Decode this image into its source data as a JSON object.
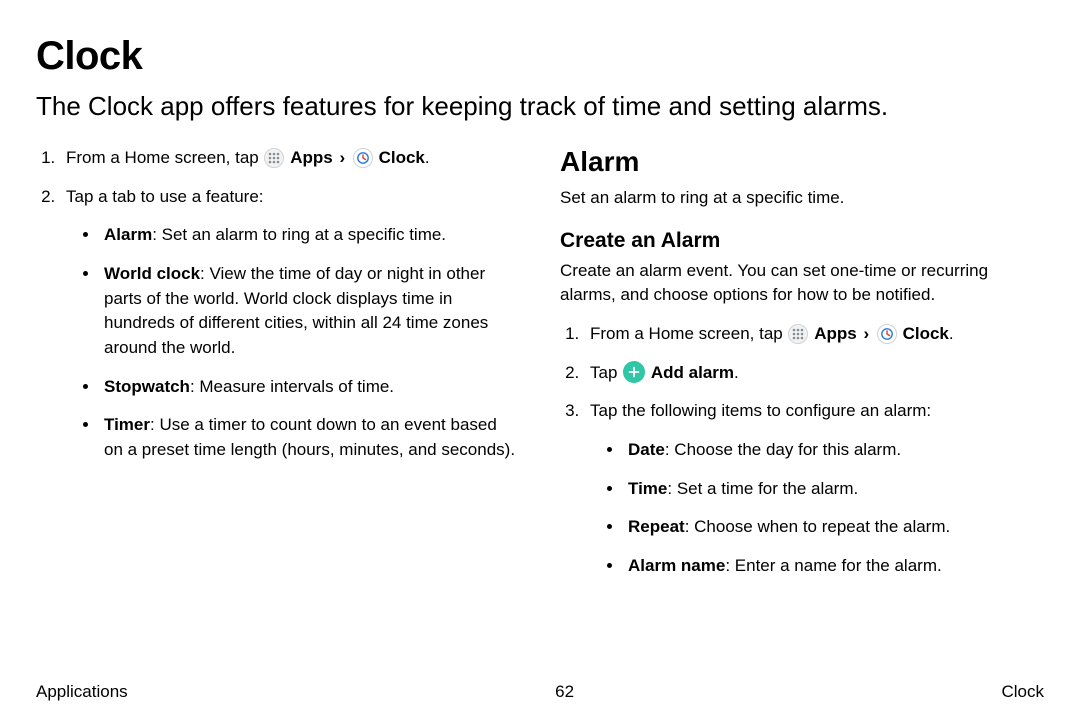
{
  "title": "Clock",
  "intro": "The Clock app offers features for keeping track of time and setting alarms.",
  "left": {
    "step1_prefix": "From a Home screen, tap ",
    "apps_label": "Apps",
    "chevron": "›",
    "clock_label": "Clock",
    "step1_suffix": ".",
    "step2": "Tap a tab to use a feature:",
    "bullets": [
      {
        "term": "Alarm",
        "desc": ": Set an alarm to ring at a specific time."
      },
      {
        "term": "World clock",
        "desc": ": View the time of day or night in other parts of the world. World clock displays time in hundreds of different cities, within all 24 time zones around the world."
      },
      {
        "term": "Stopwatch",
        "desc": ": Measure intervals of time."
      },
      {
        "term": "Timer",
        "desc": ": Use a timer to count down to an event based on a preset time length (hours, minutes, and seconds)."
      }
    ]
  },
  "right": {
    "h2": "Alarm",
    "h2_desc": "Set an alarm to ring at a specific time.",
    "h3": "Create an Alarm",
    "h3_desc": "Create an alarm event. You can set one-time or recurring alarms, and choose options for how to be notified.",
    "step1_prefix": "From a Home screen, tap ",
    "apps_label": "Apps",
    "chevron": "›",
    "clock_label": "Clock",
    "step1_suffix": ".",
    "step2_prefix": "Tap ",
    "add_alarm_label": "Add alarm",
    "step2_suffix": ".",
    "step3": "Tap the following items to configure an alarm:",
    "bullets": [
      {
        "term": "Date",
        "desc": ": Choose the day for this alarm."
      },
      {
        "term": "Time",
        "desc": ": Set a time for the alarm."
      },
      {
        "term": "Repeat",
        "desc": ": Choose when to repeat the alarm."
      },
      {
        "term": "Alarm name",
        "desc": ": Enter a name for the alarm."
      }
    ]
  },
  "footer": {
    "left": "Applications",
    "center": "62",
    "right": "Clock"
  }
}
